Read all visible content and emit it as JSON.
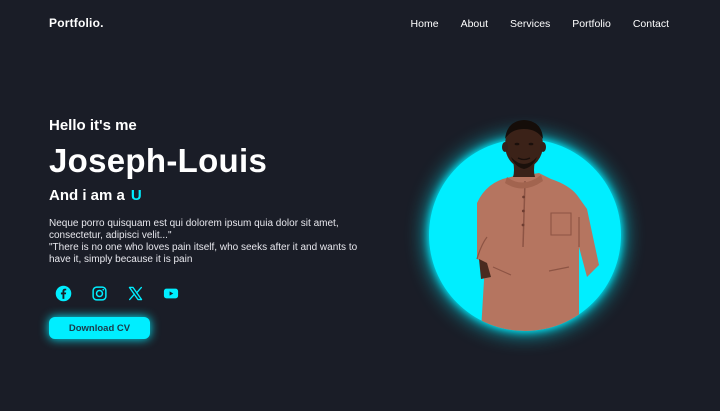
{
  "header": {
    "logo": "Portfolio.",
    "nav": [
      "Home",
      "About",
      "Services",
      "Portfolio",
      "Contact"
    ]
  },
  "hero": {
    "greeting": "Hello  it's me",
    "name": "Joseph-Louis",
    "role_prefix": "And i am a",
    "role_typed": "U",
    "description_1": "Neque porro quisquam est qui dolorem ipsum quia dolor sit amet, consectetur, adipisci velit...\"",
    "description_2": "\"There is no one who loves pain itself, who seeks after it and wants to have it, simply because it is pain",
    "download_label": "Download CV"
  },
  "socials": [
    {
      "icon": "facebook-icon"
    },
    {
      "icon": "instagram-icon"
    },
    {
      "icon": "x-icon"
    },
    {
      "icon": "youtube-icon"
    }
  ],
  "colors": {
    "background": "#1a1d27",
    "accent": "#00eeff",
    "text": "#ffffff"
  }
}
